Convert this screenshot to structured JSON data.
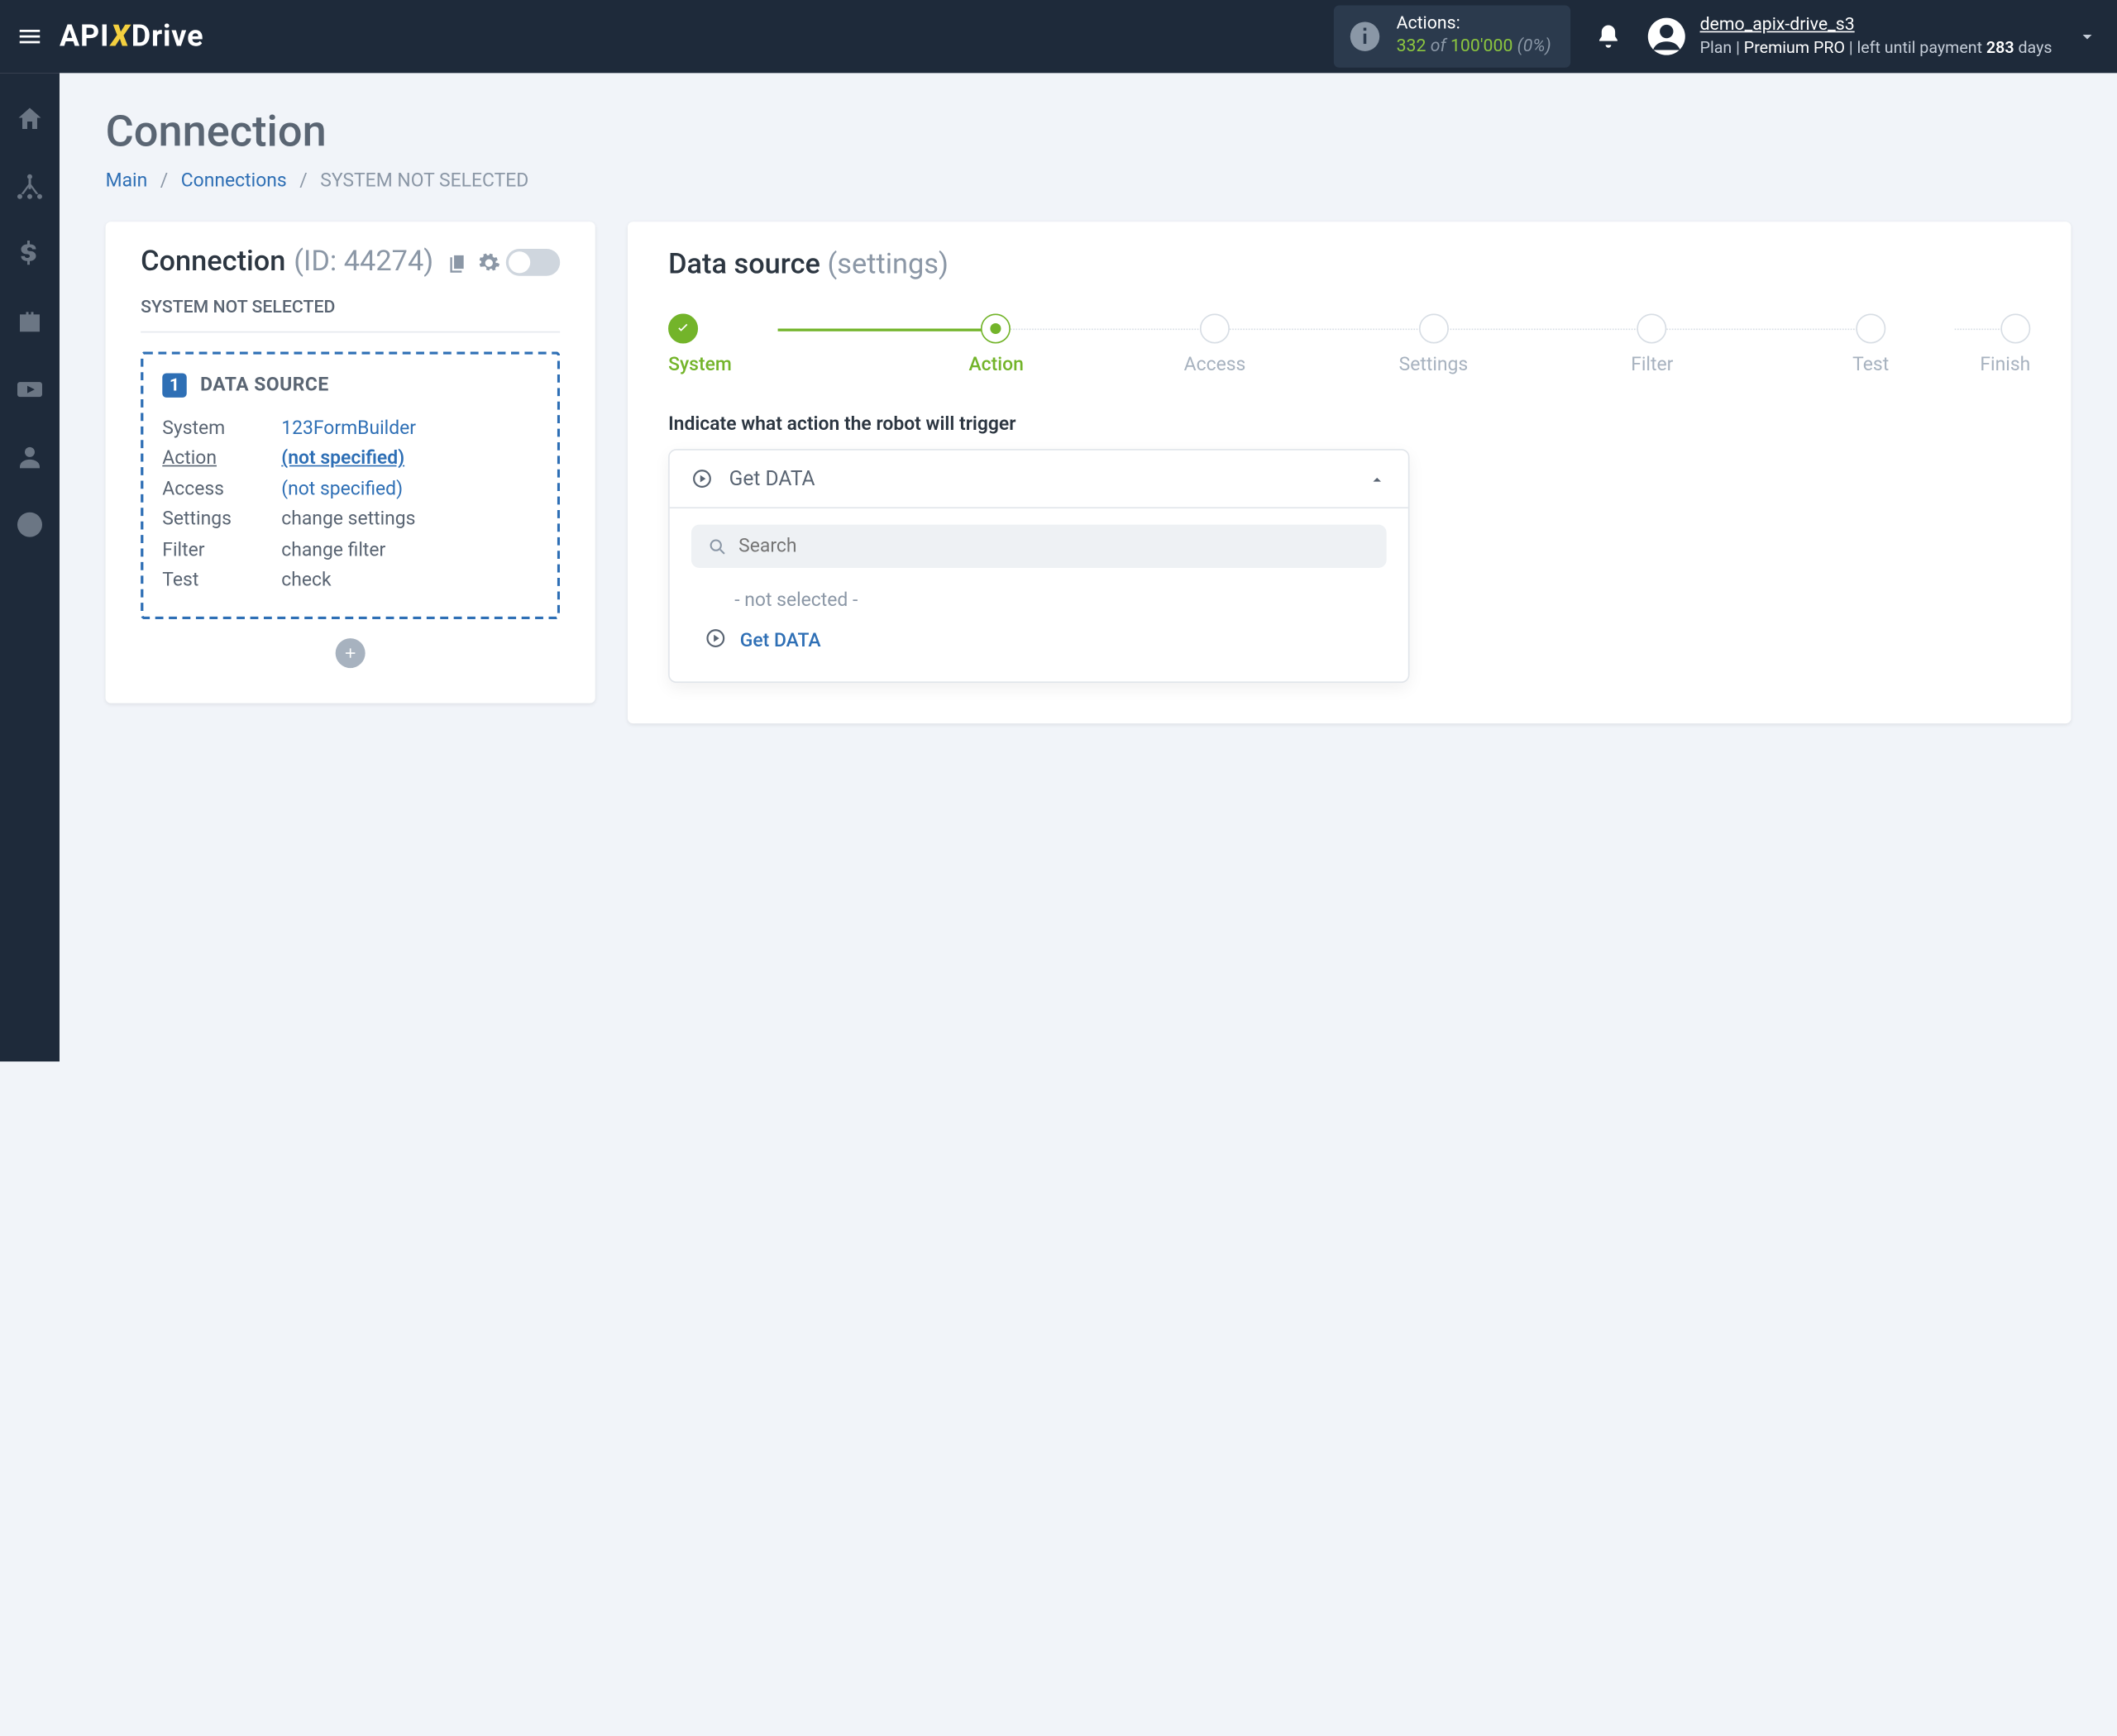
{
  "header": {
    "logo_pre": "API",
    "logo_x": "X",
    "logo_post": "Drive",
    "actions": {
      "label": "Actions:",
      "used": "332",
      "of": "of",
      "total": "100'000",
      "pct": "(0%)"
    },
    "user": {
      "name": "demo_apix-drive_s3",
      "plan_prefix": "Plan |",
      "plan_name": "Premium PRO",
      "plan_suffix": "| left until payment",
      "days_num": "283",
      "days_word": "days"
    }
  },
  "sidebar_icons": [
    "home",
    "sitemap",
    "dollar",
    "briefcase",
    "youtube",
    "user",
    "help"
  ],
  "page": {
    "title": "Connection",
    "breadcrumb": {
      "main": "Main",
      "connections": "Connections",
      "current": "SYSTEM NOT SELECTED"
    }
  },
  "left_card": {
    "title": "Connection",
    "id_label": "(ID: 44274)",
    "subtitle": "SYSTEM NOT SELECTED",
    "ds_num": "1",
    "ds_title": "DATA SOURCE",
    "rows": [
      {
        "label": "System",
        "value": "123FormBuilder",
        "link": true
      },
      {
        "label": "Action",
        "value": "(not specified)",
        "active": true
      },
      {
        "label": "Access",
        "value": "(not specified)",
        "link": true
      },
      {
        "label": "Settings",
        "value": "change settings"
      },
      {
        "label": "Filter",
        "value": "change filter"
      },
      {
        "label": "Test",
        "value": "check"
      }
    ]
  },
  "right_card": {
    "title": "Data source",
    "subtitle": "(settings)",
    "steps": [
      "System",
      "Action",
      "Access",
      "Settings",
      "Filter",
      "Test",
      "Finish"
    ],
    "section_label": "Indicate what action the robot will trigger",
    "dropdown_selected": "Get DATA",
    "search_placeholder": "Search",
    "options": {
      "placeholder": "- not selected -",
      "item": "Get DATA"
    }
  }
}
